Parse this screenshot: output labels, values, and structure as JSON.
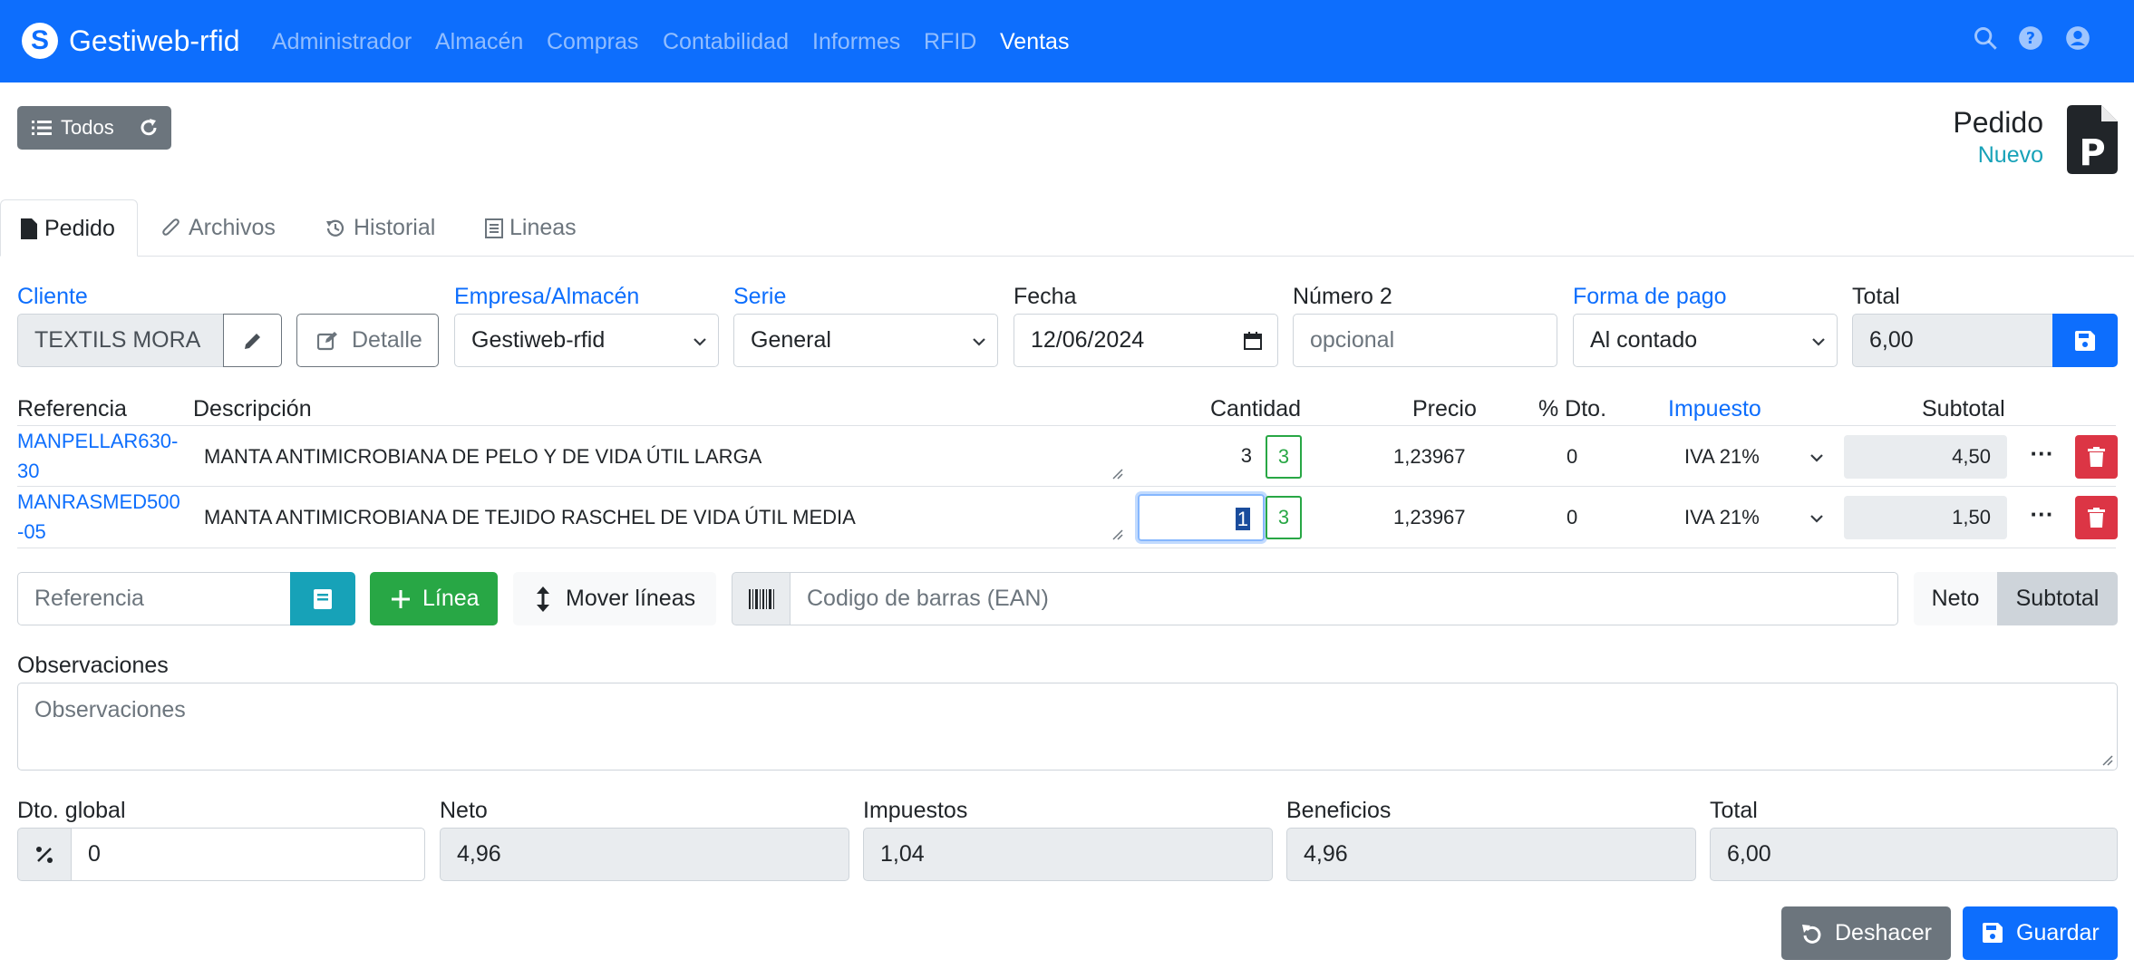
{
  "app": {
    "brand": "Gestiweb-rfid",
    "brand_initial": "S"
  },
  "nav": {
    "items": [
      {
        "label": "Administrador",
        "active": false
      },
      {
        "label": "Almacén",
        "active": false
      },
      {
        "label": "Compras",
        "active": false
      },
      {
        "label": "Contabilidad",
        "active": false
      },
      {
        "label": "Informes",
        "active": false
      },
      {
        "label": "RFID",
        "active": false
      },
      {
        "label": "Ventas",
        "active": true
      }
    ],
    "icons": [
      "search-icon",
      "help-icon",
      "user-icon"
    ]
  },
  "toolbar": {
    "todos_label": "Todos"
  },
  "document": {
    "title": "Pedido",
    "status": "Nuevo",
    "icon_letter": "P"
  },
  "tabs": [
    {
      "label": "Pedido",
      "icon": "file-icon",
      "active": true
    },
    {
      "label": "Archivos",
      "icon": "paperclip-icon",
      "active": false
    },
    {
      "label": "Historial",
      "icon": "history-icon",
      "active": false
    },
    {
      "label": "Lineas",
      "icon": "list-icon",
      "active": false
    }
  ],
  "header": {
    "cliente_label": "Cliente",
    "cliente_value": "TEXTILS MORA",
    "detalle_label": "Detalle",
    "empresa_label": "Empresa/Almacén",
    "empresa_value": "Gestiweb-rfid",
    "serie_label": "Serie",
    "serie_value": "General",
    "fecha_label": "Fecha",
    "fecha_value": "12/06/2024",
    "numero2_label": "Número 2",
    "numero2_placeholder": "opcional",
    "pago_label": "Forma de pago",
    "pago_value": "Al contado",
    "total_label": "Total",
    "total_value": "6,00"
  },
  "lines_table": {
    "headers": {
      "referencia": "Referencia",
      "descripcion": "Descripción",
      "cantidad": "Cantidad",
      "precio": "Precio",
      "dto": "% Dto.",
      "impuesto": "Impuesto",
      "subtotal": "Subtotal"
    },
    "rows": [
      {
        "referencia": "MANPELLAR630-30",
        "descripcion": "MANTA ANTIMICROBIANA DE PELO Y DE VIDA ÚTIL LARGA",
        "cantidad": "3",
        "stock": "3",
        "precio": "1,23967",
        "dto": "0",
        "impuesto": "IVA 21%",
        "subtotal": "4,50",
        "more": "···"
      },
      {
        "referencia": "MANRASMED500-05",
        "descripcion": "MANTA ANTIMICROBIANA DE TEJIDO RASCHEL DE VIDA ÚTIL MEDIA",
        "cantidad": "1",
        "stock": "3",
        "precio": "1,23967",
        "dto": "0",
        "impuesto": "IVA 21%",
        "subtotal": "1,50",
        "more": "···"
      }
    ]
  },
  "actions": {
    "referencia_placeholder": "Referencia",
    "linea_label": "Línea",
    "mover_label": "Mover líneas",
    "ean_placeholder": "Codigo de barras (EAN)",
    "neto_label": "Neto",
    "subtotal_label": "Subtotal"
  },
  "observaciones": {
    "label": "Observaciones",
    "placeholder": "Observaciones"
  },
  "totals": {
    "dto_global_label": "Dto. global",
    "dto_global_value": "0",
    "neto_label": "Neto",
    "neto_value": "4,96",
    "impuestos_label": "Impuestos",
    "impuestos_value": "1,04",
    "beneficios_label": "Beneficios",
    "beneficios_value": "4,96",
    "total_label": "Total",
    "total_value": "6,00"
  },
  "footer_buttons": {
    "deshacer_label": "Deshacer",
    "guardar_label": "Guardar"
  },
  "colors": {
    "primary": "#0d6efd",
    "success": "#28a745",
    "danger": "#dc3545",
    "info": "#17a2b8",
    "secondary": "#6c757d"
  }
}
